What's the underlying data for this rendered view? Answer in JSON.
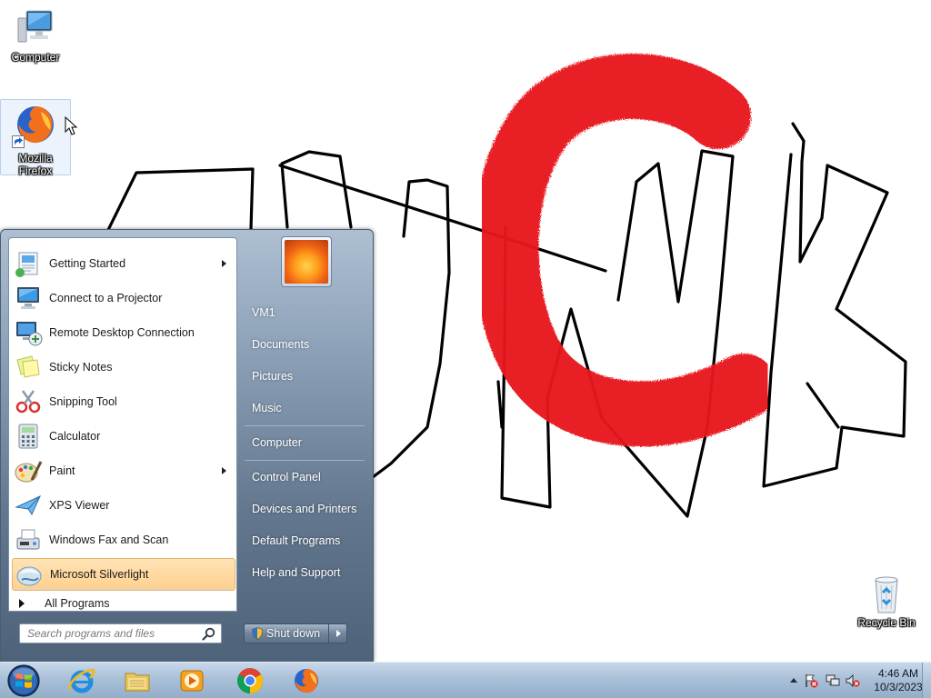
{
  "desktop": {
    "icons": [
      {
        "label": "Computer",
        "icon": "computer-icon"
      },
      {
        "label": "Mozilla Firefox",
        "icon": "firefox-icon"
      },
      {
        "label": "Recycle Bin",
        "icon": "recycle-bin-icon"
      }
    ],
    "drawing": {
      "stroke_color": "#000000",
      "fill_color": "#e8141b"
    }
  },
  "start_menu": {
    "programs": [
      {
        "label": "Getting Started",
        "icon": "getting-started-icon",
        "has_submenu": true,
        "highlighted": false
      },
      {
        "label": "Connect to a Projector",
        "icon": "projector-icon",
        "has_submenu": false,
        "highlighted": false
      },
      {
        "label": "Remote Desktop Connection",
        "icon": "remote-desktop-icon",
        "has_submenu": false,
        "highlighted": false
      },
      {
        "label": "Sticky Notes",
        "icon": "sticky-notes-icon",
        "has_submenu": false,
        "highlighted": false
      },
      {
        "label": "Snipping Tool",
        "icon": "snipping-tool-icon",
        "has_submenu": false,
        "highlighted": false
      },
      {
        "label": "Calculator",
        "icon": "calculator-icon",
        "has_submenu": false,
        "highlighted": false
      },
      {
        "label": "Paint",
        "icon": "paint-icon",
        "has_submenu": true,
        "highlighted": false
      },
      {
        "label": "XPS Viewer",
        "icon": "xps-viewer-icon",
        "has_submenu": false,
        "highlighted": false
      },
      {
        "label": "Windows Fax and Scan",
        "icon": "fax-scan-icon",
        "has_submenu": false,
        "highlighted": false
      },
      {
        "label": "Microsoft Silverlight",
        "icon": "silverlight-icon",
        "has_submenu": false,
        "highlighted": true
      }
    ],
    "all_programs": "All Programs",
    "search_placeholder": "Search programs and files",
    "right_links": [
      "VM1",
      "Documents",
      "Pictures",
      "Music",
      "Computer",
      "Control Panel",
      "Devices and Printers",
      "Default Programs",
      "Help and Support"
    ],
    "shutdown_label": "Shut down",
    "highlight_color": "#ffd08e"
  },
  "taskbar": {
    "pinned": [
      {
        "name": "internet-explorer-icon"
      },
      {
        "name": "windows-explorer-icon"
      },
      {
        "name": "media-player-icon"
      },
      {
        "name": "chrome-icon"
      },
      {
        "name": "firefox-icon"
      }
    ],
    "tray_icons": [
      "show-hidden-icons-icon",
      "action-center-flag-icon",
      "network-icon",
      "volume-muted-icon"
    ],
    "clock": {
      "time": "4:46 AM",
      "date": "10/3/2023"
    }
  }
}
